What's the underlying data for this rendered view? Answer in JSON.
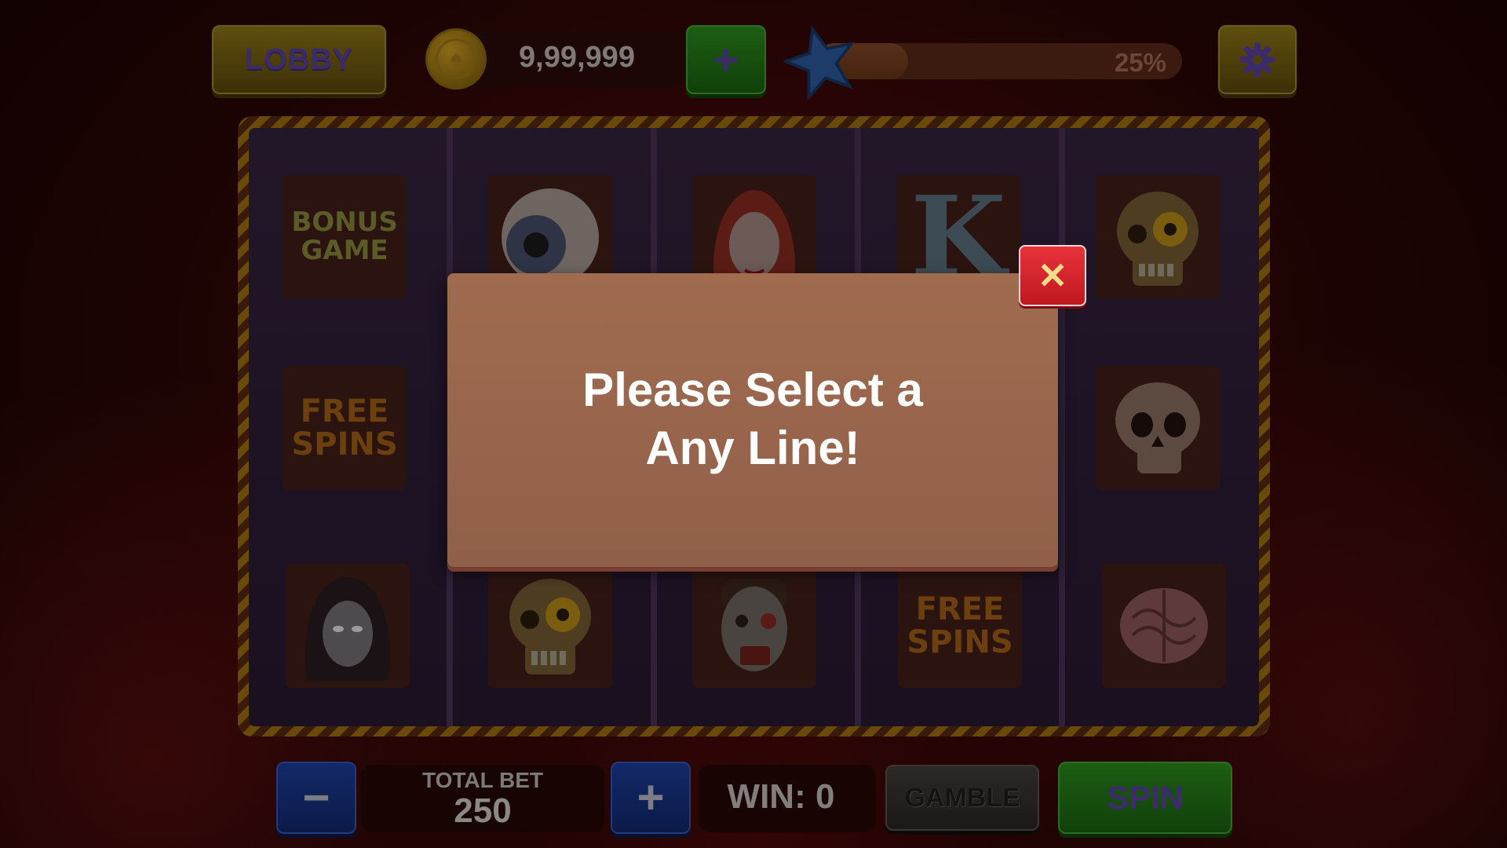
{
  "header": {
    "lobby_label": "LOBBY",
    "coin_balance": "9,99,999",
    "add_coins_label": "+",
    "xp_percent_label": "25%",
    "xp_progress": 0.25,
    "settings_icon": "gear-icon",
    "star_icon": "star-icon"
  },
  "reels": {
    "symbols": [
      [
        "bonus-game",
        "free-spins",
        "vampire-woman"
      ],
      [
        "eyeball",
        "",
        "zombie-skull"
      ],
      [
        "vampire-girl",
        "",
        "zombie-face"
      ],
      [
        "letter-k",
        "",
        "free-spins"
      ],
      [
        "zombie-skull",
        "skull",
        "brain"
      ]
    ],
    "bonus_game_text": "BONUS GAME",
    "free_spins_text": "FREE SPINS",
    "k_letter": "K"
  },
  "modal": {
    "message_line1": "Please Select a",
    "message_line2": "Any Line!",
    "close_label": "✕"
  },
  "footer": {
    "minus_label": "−",
    "plus_label": "+",
    "total_bet_label": "TOTAL BET",
    "total_bet_value": "250",
    "win_label": "WIN: 0",
    "gamble_label": "GAMBLE",
    "spin_label": "SPIN"
  },
  "colors": {
    "modal_bg": "#9c684d",
    "close_red": "#d8262e",
    "frame_stripe": "#6a4a0a"
  }
}
